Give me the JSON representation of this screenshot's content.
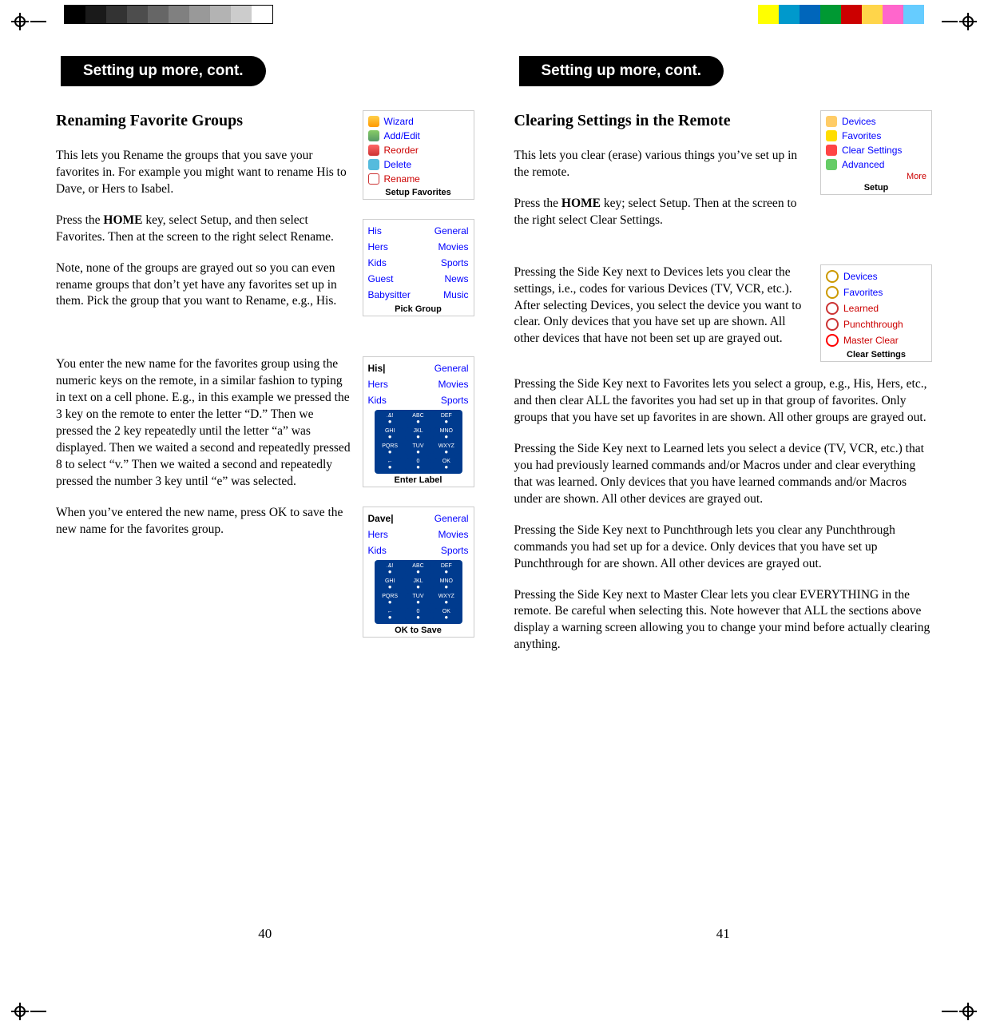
{
  "left": {
    "header": "Setting up more, cont.",
    "title": "Renaming Favorite Groups",
    "p1a": "This lets you Rename the groups that you save your favorites in. For example you might want to rename His to Dave, or Hers to Isabel.",
    "p1b_pre": "Press the ",
    "p1b_key": "HOME",
    "p1b_post": " key, select Setup, and then select Favorites. Then at the screen to the right select Rename.",
    "p2": "Note, none of the groups are grayed out so you can even rename groups that don’t yet have any favorites set up in them. Pick the group that you want to Rename, e.g., His.",
    "p3": "You enter the new name for the favorites group using the numeric keys on the remote, in a similar fashion to typing in text on a cell phone. E.g., in this example we pressed the 3 key on the remote to enter the letter “D.” Then we pressed the 2 key repeatedly until the letter “a” was displayed. Then we waited a second and repeatedly pressed 8 to select “v.” Then we waited a second and repeatedly pressed the number 3 key until “e” was selected.",
    "p4": "When you’ve entered the new name, press OK to save the new name for the favorites group.",
    "panel_setup": {
      "items": [
        "Wizard",
        "Add/Edit",
        "Reorder",
        "Delete",
        "Rename"
      ],
      "caption": "Setup Favorites"
    },
    "panel_pick": {
      "left_items": [
        "His",
        "Hers",
        "Kids",
        "Guest",
        "Babysitter"
      ],
      "right_items": [
        "General",
        "Movies",
        "Sports",
        "News",
        "Music"
      ],
      "caption": "Pick Group"
    },
    "panel_enter": {
      "active": "His|",
      "rows": [
        [
          "Hers",
          "Movies"
        ],
        [
          "Kids",
          "Sports"
        ]
      ],
      "right_top": "General",
      "caption": "Enter Label"
    },
    "panel_save": {
      "active": "Dave|",
      "rows": [
        [
          "Hers",
          "Movies"
        ],
        [
          "Kids",
          "Sports"
        ]
      ],
      "right_top": "General",
      "caption": "OK to Save"
    },
    "page_num": "40"
  },
  "right": {
    "header": "Setting up more, cont.",
    "title": "Clearing Settings in the Remote",
    "p1": "This lets you clear (erase) various things you’ve set up in the remote.",
    "p2_pre": "Press the ",
    "p2_key": "HOME",
    "p2_post": " key; select Setup. Then at the screen to the right select Clear Settings.",
    "p3": "Pressing the Side Key next to Devices lets you clear the settings, i.e., codes for various Devices (TV, VCR, etc.). After selecting Devices, you select the device you want to clear. Only devices that you have set up are shown. All other devices that have not been set up are grayed out.",
    "p4": "Pressing the Side Key next to Favorites lets you select a group, e.g., His, Hers, etc., and then clear ALL the favorites you had set up in that group of favorites. Only groups that you have set up favorites in are shown. All other groups are grayed out.",
    "p5": "Pressing the Side Key next to Learned lets you select a device (TV, VCR, etc.) that you had previously learned commands and/or Macros under and clear everything that was learned. Only devices that you have learned commands and/or Macros under are shown. All other devices are grayed out.",
    "p6": "Pressing the Side Key next to Punchthrough lets you clear any Punchthrough commands you had set up for a device. Only devices that you have set up Punchthrough for are shown. All other devices are grayed out.",
    "p7": "Pressing the Side Key next to Master Clear lets you clear EVERYTHING in the remote. Be careful when selecting this. Note however that ALL the sections above display a warning screen allowing you to change your mind before actually clearing anything.",
    "panel_setup": {
      "items": [
        "Devices",
        "Favorites",
        "Clear Settings",
        "Advanced"
      ],
      "more": "More",
      "caption": "Setup"
    },
    "panel_clear": {
      "items": [
        "Devices",
        "Favorites",
        "Learned",
        "Punchthrough",
        "Master Clear"
      ],
      "caption": "Clear Settings"
    },
    "page_num": "41"
  },
  "keypad_keys": [
    ".&!",
    "ABC",
    "DEF",
    "GHI",
    "JKL",
    "MNO",
    "PQRS",
    "TUV",
    "WXYZ",
    "←",
    "0",
    "OK"
  ]
}
